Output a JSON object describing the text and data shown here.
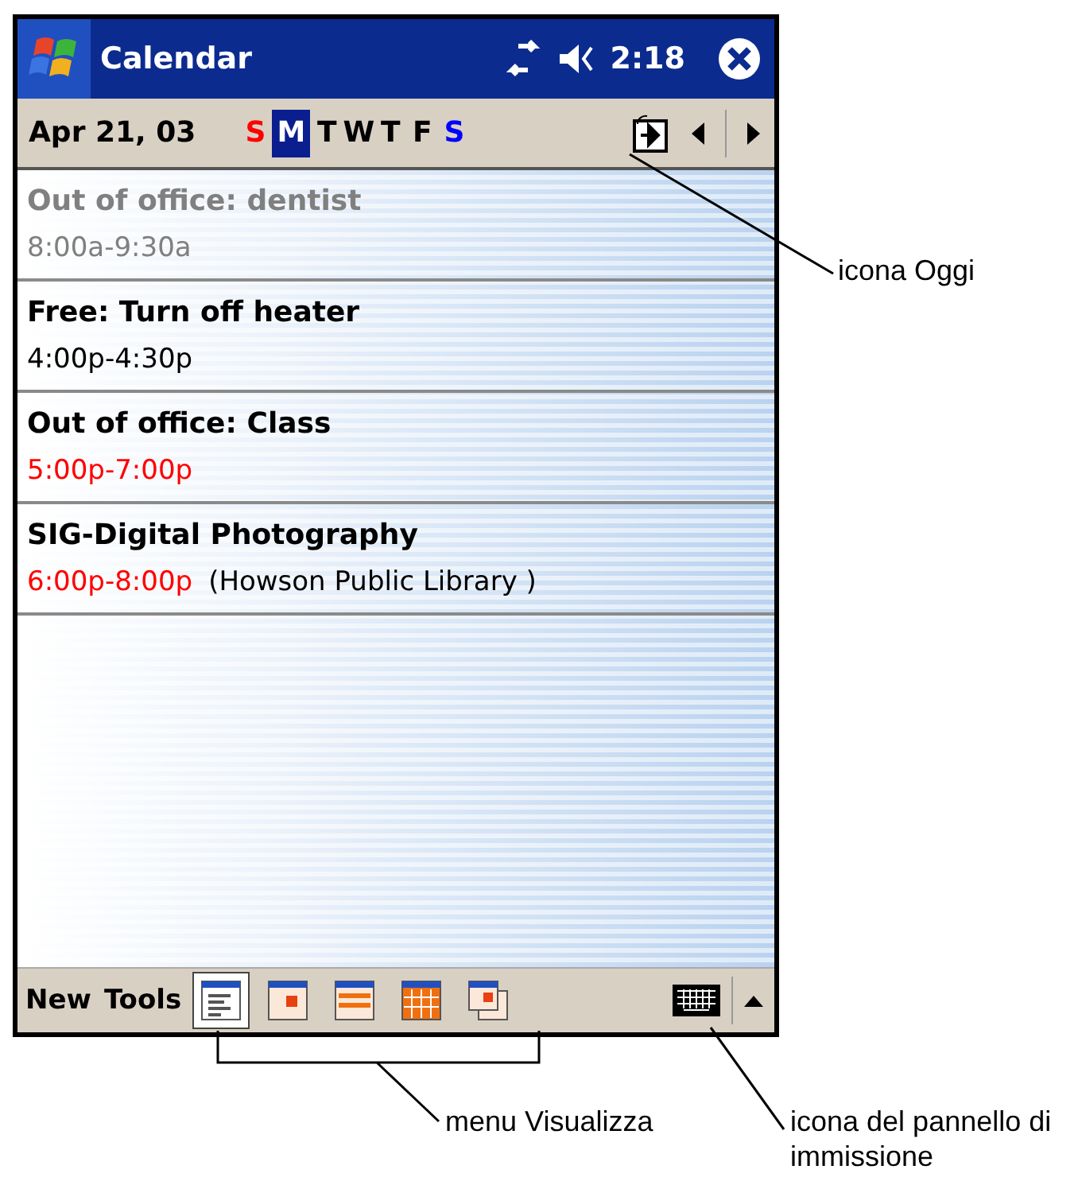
{
  "window": {
    "title": "Calendar",
    "time": "2:18"
  },
  "date_bar": {
    "date": "Apr 21, 03",
    "days": [
      {
        "label": "S",
        "color": "#ff0000",
        "selected": false
      },
      {
        "label": "M",
        "selected": true
      },
      {
        "label": "T",
        "color": "#000000",
        "selected": false
      },
      {
        "label": "W",
        "color": "#000000",
        "selected": false
      },
      {
        "label": "T",
        "color": "#000000",
        "selected": false
      },
      {
        "label": "F",
        "color": "#000000",
        "selected": false
      },
      {
        "label": "S",
        "color": "#0000ff",
        "selected": false
      }
    ]
  },
  "appointments": [
    {
      "title": "Out of office: dentist",
      "time": "8:00a-9:30a",
      "past": true,
      "color": "#808080"
    },
    {
      "title": "Free: Turn off heater",
      "time": "4:00p-4:30p",
      "past": false,
      "color": "#000000"
    },
    {
      "title": "Out of office: Class",
      "time": "5:00p-7:00p",
      "past": false,
      "color": "#ff0000"
    },
    {
      "title": "SIG-Digital Photography",
      "time": "6:00p-8:00p",
      "location": "(Howson Public Library )",
      "past": false,
      "color": "#ff0000"
    }
  ],
  "toolbar": {
    "menus": [
      "New",
      "Tools"
    ],
    "views": [
      {
        "kind": "agenda",
        "selected": true
      },
      {
        "kind": "day",
        "selected": false
      },
      {
        "kind": "week",
        "selected": false
      },
      {
        "kind": "month",
        "selected": false
      },
      {
        "kind": "year",
        "selected": false
      }
    ]
  },
  "callouts": {
    "today": "icona Oggi",
    "views": "menu Visualizza",
    "input_panel": "icona del pannello di immissione"
  }
}
